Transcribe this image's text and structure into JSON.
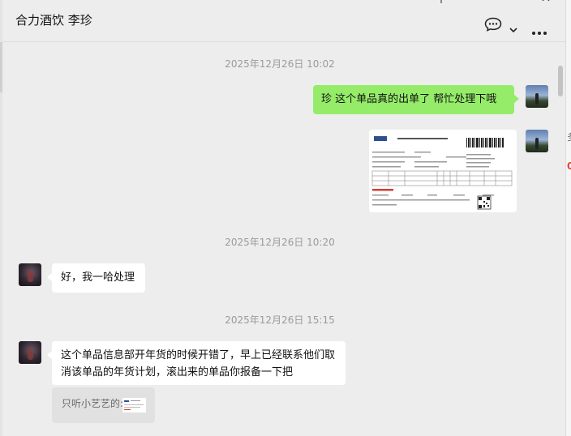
{
  "header": {
    "title": "合力酒饮 李珍"
  },
  "messages": [
    {
      "type": "timestamp",
      "text": "2025年12月26日 10:02"
    },
    {
      "type": "text",
      "from": "self",
      "text": "珍  这个单品真的出单了  帮忙处理下哦"
    },
    {
      "type": "image",
      "from": "self",
      "content": "order-receipt"
    },
    {
      "type": "timestamp",
      "text": "2025年12月26日 10:20"
    },
    {
      "type": "text",
      "from": "other",
      "text": "好，我一哈处理"
    },
    {
      "type": "timestamp",
      "text": "2025年12月26日 15:15"
    },
    {
      "type": "text",
      "from": "other",
      "lines": [
        "这个单品信息部开年货的时候开错了，早上已经联系他们取",
        "消该单品的年货计划，滚出来的单品你报备一下把"
      ]
    },
    {
      "type": "quote",
      "text": "只听小艺艺的:"
    }
  ],
  "colors": {
    "self_bubble": "#95ec69",
    "other_bubble": "#ffffff",
    "background": "#ededed"
  }
}
